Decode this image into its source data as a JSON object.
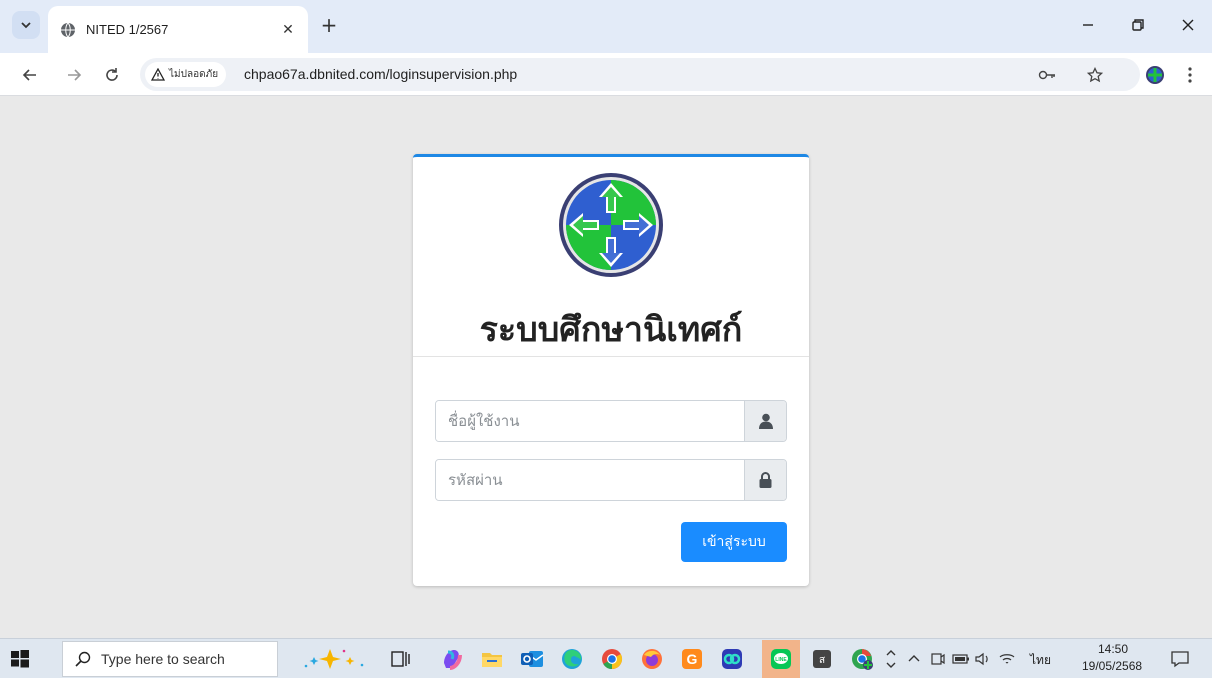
{
  "browser": {
    "tab_title": "NITED 1/2567",
    "security_label": "ไม่ปลอดภัย",
    "url": "chpao67a.dbnited.com/loginsupervision.php"
  },
  "login": {
    "title": "ระบบศึกษานิเทศก์",
    "username_placeholder": "ชื่อผู้ใช้งาน",
    "password_placeholder": "รหัสผ่าน",
    "submit_label": "เข้าสู่ระบบ"
  },
  "colors": {
    "accent": "#1a8cff",
    "card_border": "#1e88e5",
    "logo_blue": "#2f5fd0",
    "logo_green": "#22c33a",
    "logo_ring": "#3a3f73"
  },
  "taskbar": {
    "search_placeholder": "Type here to search",
    "language": "ไทย",
    "time": "14:50",
    "date": "19/05/2568"
  },
  "icons": [
    "tab-search-icon",
    "globe-icon",
    "close-icon",
    "plus-icon",
    "minimize-icon",
    "restore-icon",
    "back-icon",
    "forward-icon",
    "reload-icon",
    "warning-icon",
    "key-icon",
    "star-icon",
    "profile-icon",
    "more-icon",
    "user-icon",
    "lock-icon",
    "windows-icon",
    "search-icon",
    "copilot-icon",
    "task-view-icon",
    "edge-icon",
    "chrome-icon",
    "firefox-icon",
    "line-icon"
  ]
}
